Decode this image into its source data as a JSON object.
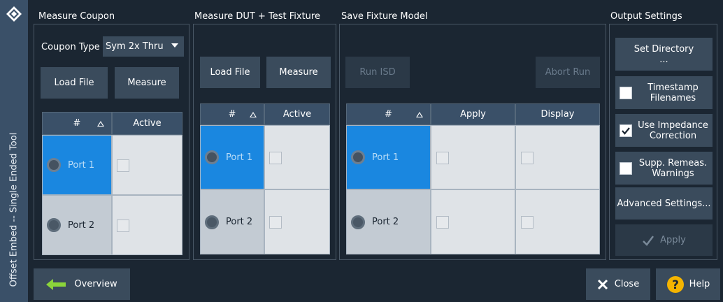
{
  "app": {
    "sidebar_title": "Offset Embed -- Single Ended Tool"
  },
  "sections": {
    "coupon": "Measure Coupon",
    "dut": "Measure DUT + Test Fixture",
    "save": "Save Fixture Model",
    "output": "Output Settings"
  },
  "coupon": {
    "type_label": "Coupon Type",
    "type_value": "Sym 2x Thru",
    "load_file": "Load File",
    "measure": "Measure",
    "columns": [
      "#",
      "Active"
    ],
    "rows": [
      {
        "port": "Port 1",
        "selected": true,
        "active": false
      },
      {
        "port": "Port 2",
        "selected": false,
        "active": false
      }
    ]
  },
  "dut": {
    "load_file": "Load File",
    "measure": "Measure",
    "columns": [
      "#",
      "Active"
    ],
    "rows": [
      {
        "port": "Port 1",
        "selected": true,
        "active": false
      },
      {
        "port": "Port 2",
        "selected": false,
        "active": false
      }
    ]
  },
  "save": {
    "run_isd": "Run ISD",
    "abort_run": "Abort Run",
    "columns": [
      "#",
      "Apply",
      "Display"
    ],
    "rows": [
      {
        "port": "Port 1",
        "selected": true,
        "apply": false,
        "display": false
      },
      {
        "port": "Port 2",
        "selected": false,
        "apply": false,
        "display": false
      }
    ]
  },
  "output": {
    "set_directory": "Set Directory ...",
    "timestamp": {
      "label": "Timestamp Filenames",
      "checked": false
    },
    "impedance": {
      "label": "Use Impedance Correction",
      "checked": true
    },
    "supp_remeas": {
      "label": "Supp. Remeas. Warnings",
      "checked": false
    },
    "advanced": "Advanced Settings...",
    "apply": "Apply"
  },
  "footer": {
    "overview": "Overview",
    "close": "Close",
    "help": "Help"
  },
  "colors": {
    "background": "#1b2632",
    "sidebar": "#3a5068",
    "button": "#3a4b5c",
    "selected_port": "#1a87e0",
    "help_icon": "#f4b400",
    "overview_arrow": "#8bd53a"
  }
}
